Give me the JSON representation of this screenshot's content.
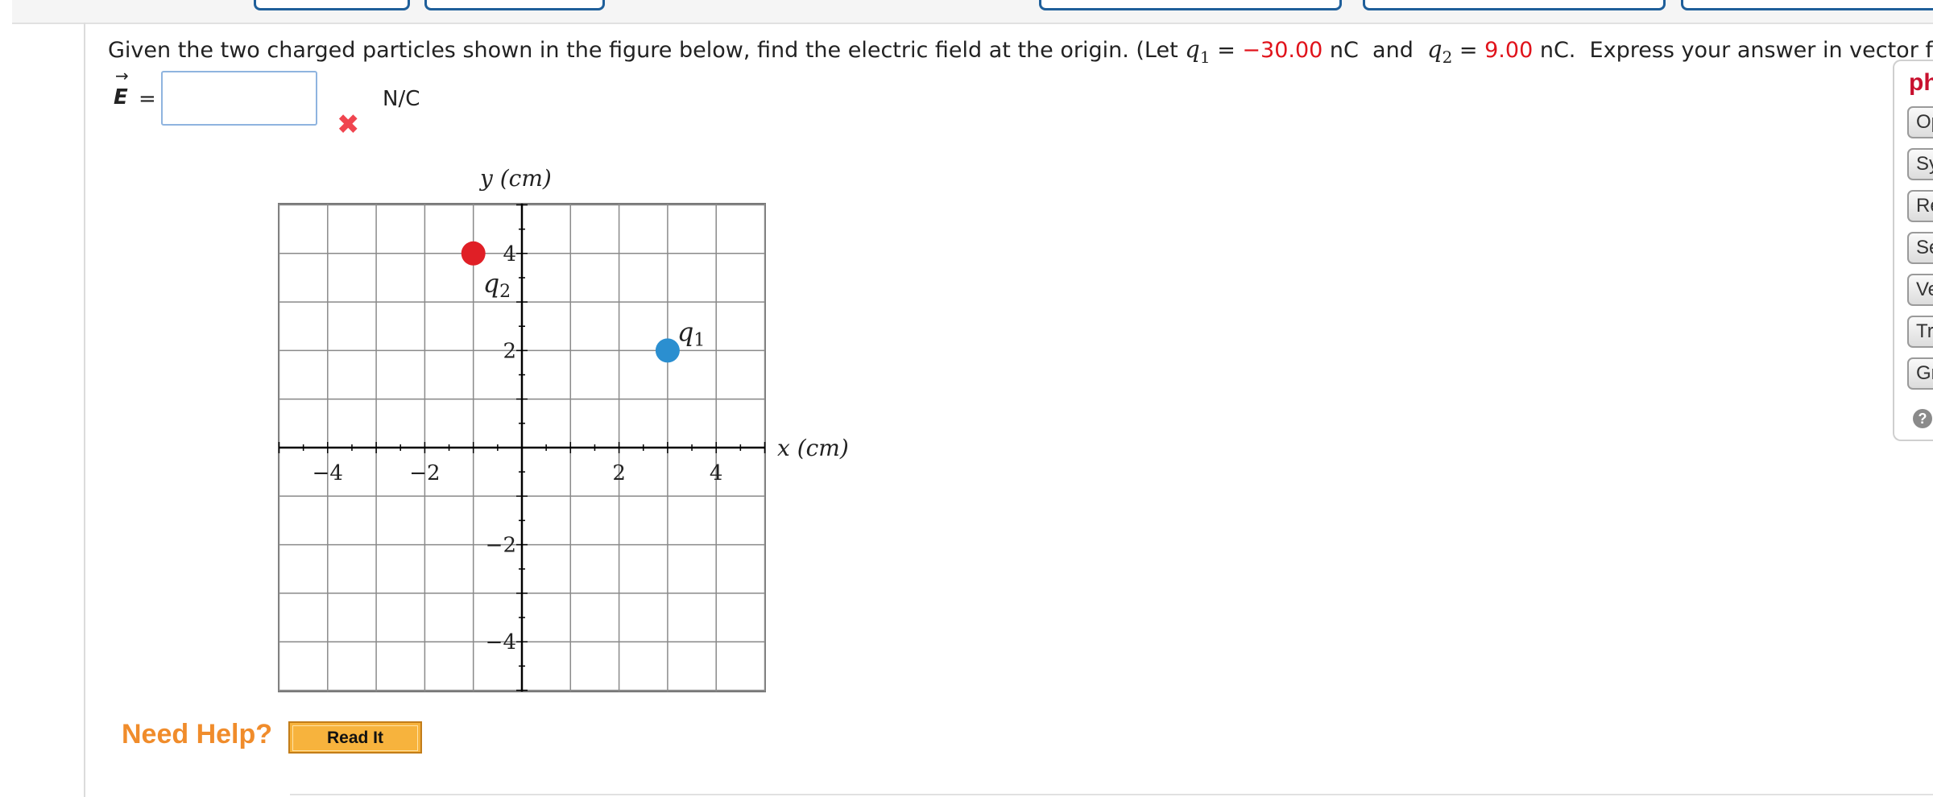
{
  "question": {
    "prefix": "Given the two charged particles shown in the figure below, find the electric field at the origin. (Let",
    "q1_symbol": "q",
    "q1_sub": "1",
    "eq1": " = ",
    "q1_value": "−30.00",
    "q1_unit": " nC  and ",
    "q2_symbol": "q",
    "q2_sub": "2",
    "eq2": " = ",
    "q2_value": "9.00",
    "q2_unit": " nC.  Express your answer in vector form."
  },
  "answer": {
    "label": "E",
    "arrow": "→",
    "equals": "=",
    "value": "",
    "units": "N/C",
    "status_mark": "✖"
  },
  "graph": {
    "x_axis_label": "x (cm)",
    "y_axis_label": "y (cm)",
    "x_ticks": [
      "−4",
      "−2",
      "2",
      "4"
    ],
    "y_ticks": [
      "4",
      "2",
      "−2",
      "−4"
    ],
    "charges": [
      {
        "name": "q1",
        "symbol": "q",
        "sub": "1",
        "x": 3,
        "y": 2,
        "color": "#2b8fd0"
      },
      {
        "name": "q2",
        "symbol": "q",
        "sub": "2",
        "x": -1,
        "y": 4,
        "color": "#e01f26"
      }
    ],
    "xlim": [
      -5,
      5
    ],
    "ylim": [
      -5,
      5
    ]
  },
  "help": {
    "label": "Need Help?",
    "read_it": "Read It"
  },
  "side_panel": {
    "title": "ph",
    "buttons": [
      "Op",
      "Sy",
      "Re",
      "Se",
      "Ve",
      "Tr",
      "Gr"
    ],
    "help_icon": "?"
  }
}
